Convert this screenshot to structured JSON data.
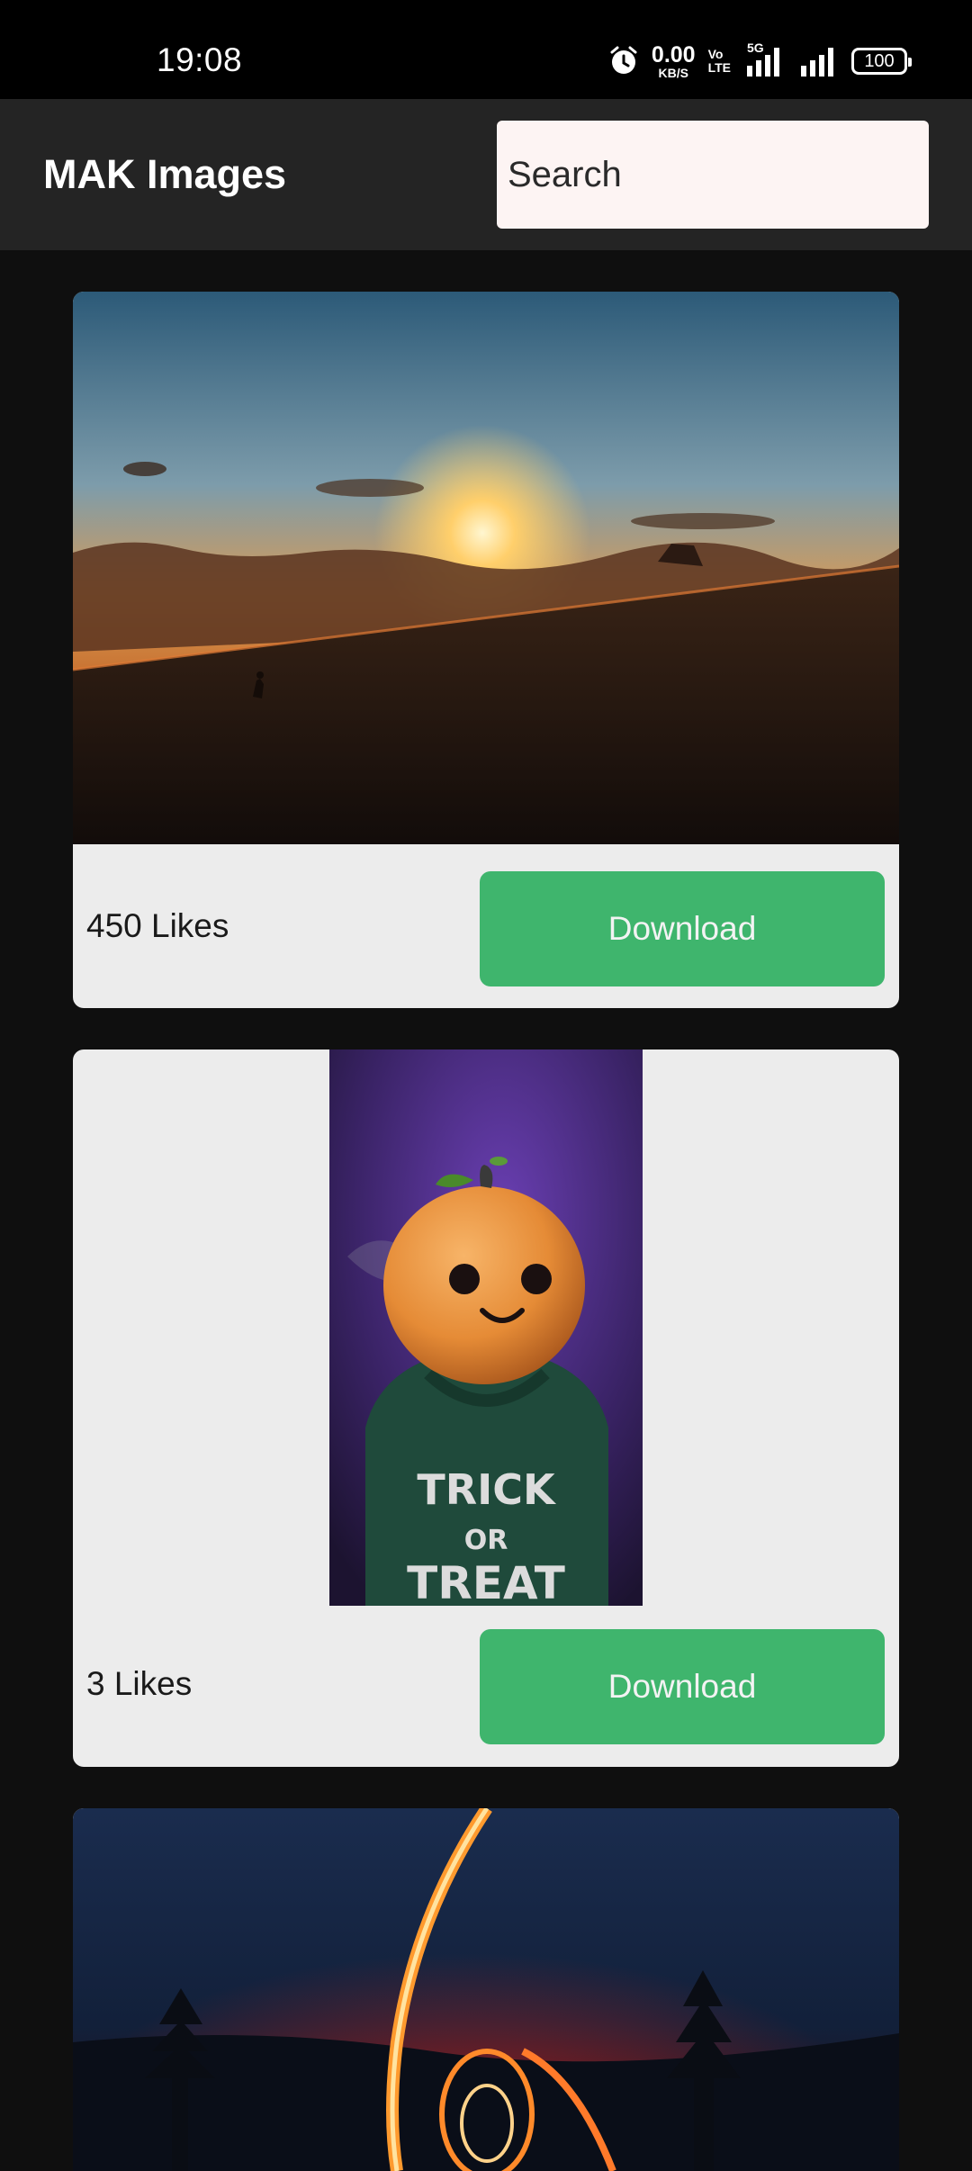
{
  "status_bar": {
    "time": "19:08",
    "net_speed_value": "0.00",
    "net_speed_unit": "KB/S",
    "volte_top": "Vo",
    "volte_bottom": "LTE",
    "network_type": "5G",
    "battery": "100",
    "icons": [
      "alarm-icon",
      "signal-icon",
      "signal-icon"
    ]
  },
  "app_bar": {
    "title": "MAK Images",
    "search_placeholder": "Search"
  },
  "cards": [
    {
      "image": "desert-sunset-photo",
      "likes": "450 Likes",
      "download_label": "Download"
    },
    {
      "image": "pumpkin-head-photo",
      "likes": "3 Likes",
      "download_label": "Download"
    },
    {
      "image": "light-trail-forest-photo"
    }
  ]
}
